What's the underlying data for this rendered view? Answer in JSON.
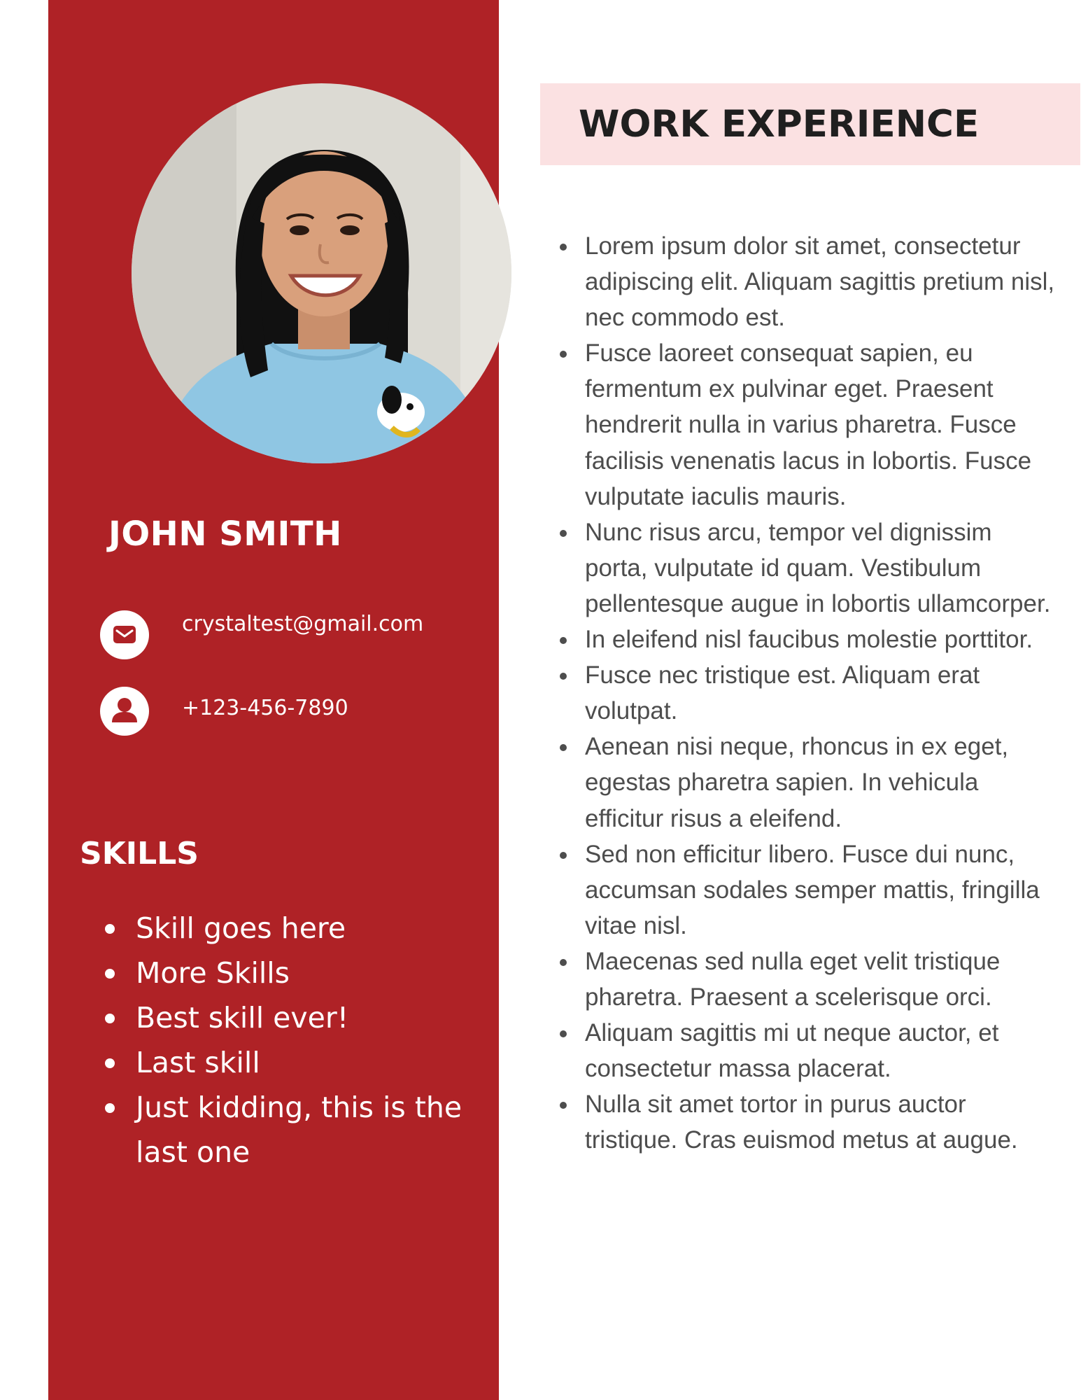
{
  "profile": {
    "name": "JOHN SMITH",
    "email": "crystaltest@gmail.com",
    "phone": "+123-456-7890",
    "photo_alt": "profile-photo"
  },
  "skills": {
    "title": "SKILLS",
    "items": [
      "Skill goes here",
      "More Skills",
      "Best skill ever!",
      "Last skill",
      "Just kidding, this is the last one"
    ]
  },
  "work": {
    "title": "WORK EXPERIENCE",
    "items": [
      "Lorem ipsum dolor sit amet, consectetur adipiscing elit. Aliquam sagittis pretium nisl, nec commodo est.",
      "Fusce laoreet consequat sapien, eu fermentum ex pulvinar eget. Praesent hendrerit nulla in varius pharetra. Fusce facilisis venenatis lacus in lobortis. Fusce vulputate iaculis mauris.",
      "Nunc risus arcu, tempor vel dignissim porta, vulputate id quam. Vestibulum pellentesque augue in lobortis ullamcorper.",
      "In eleifend nisl faucibus molestie porttitor.",
      "Fusce nec tristique est. Aliquam erat volutpat.",
      "Aenean nisi neque, rhoncus in ex eget, egestas pharetra sapien. In vehicula efficitur risus a eleifend.",
      "Sed non efficitur libero. Fusce dui nunc, accumsan sodales semper mattis, fringilla vitae nisl.",
      "Maecenas sed nulla eget velit tristique pharetra. Praesent a scelerisque orci.",
      "Aliquam sagittis mi ut neque auctor, et consectetur massa placerat.",
      "Nulla sit amet tortor in purus auctor tristique. Cras euismod metus at augue."
    ]
  },
  "colors": {
    "sidebar": "#af2226",
    "header_band": "#fbe1e2",
    "body_text": "#4d4d4d",
    "heading_text": "#1f1f1f"
  },
  "icons": {
    "email": "mail-icon",
    "phone": "user-icon"
  }
}
